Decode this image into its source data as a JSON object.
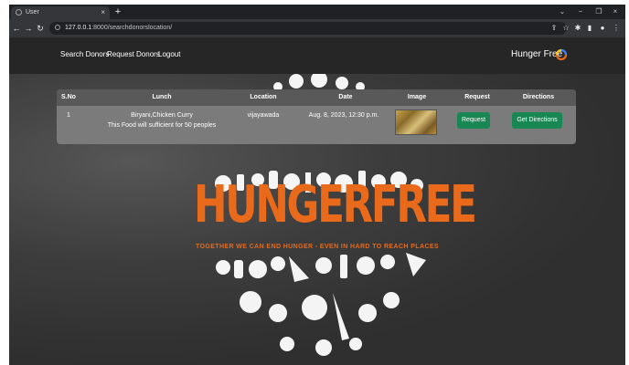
{
  "browser": {
    "tab_title": "User",
    "tab_close": "×",
    "new_tab": "+",
    "url_host": "127.0.0.1",
    "url_rest": ":8000/searchdonorslocation/",
    "window_controls": [
      "⌄",
      "−",
      "❐",
      "×"
    ]
  },
  "navbar": {
    "links": [
      "Search Donors",
      "Request Donors",
      "Logout"
    ],
    "brand": "Hunger Free"
  },
  "hero": {
    "word": "HUNGERFREE",
    "tagline": "TOGETHER WE CAN END HUNGER - EVEN IN HARD TO REACH PLACES"
  },
  "table": {
    "headers": [
      "S.No",
      "Lunch",
      "Location",
      "Date",
      "Image",
      "Request",
      "Directions"
    ],
    "rows": [
      {
        "sno": "1",
        "lunch_line1": "Biryani,Chicken Curry",
        "lunch_line2": "This Food will sufficient for 50 peoples",
        "location": "vijayawada",
        "date": "Aug. 8, 2023, 12:30 p.m.",
        "request_label": "Request",
        "directions_label": "Get Directions"
      }
    ]
  },
  "colors": {
    "accent": "#e86a1a",
    "button": "#198754"
  }
}
